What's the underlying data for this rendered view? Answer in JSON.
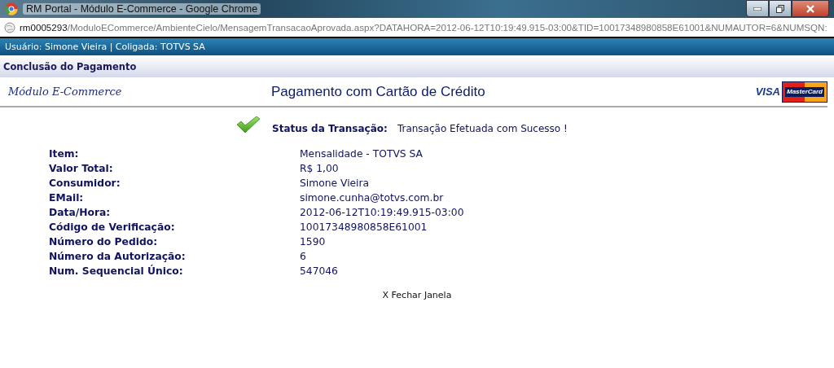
{
  "window": {
    "title": "RM Portal - Módulo E-Commerce - Google Chrome"
  },
  "address_bar": {
    "host": "rm0005293",
    "path": "/ModuloECommerce/AmbienteCielo/MensagemTransacaoAprovada.aspx?DATAHORA=2012-06-12T10:19:49.915-03:00&TID=10017348980858E61001&NUMAUTOR=6&NUMSQN:"
  },
  "user_bar": "Usuário: Simone Vieira | Coligada: TOTVS SA",
  "section_title": "Conclusão do Pagamento",
  "header": {
    "module": "Módulo E-Commerce",
    "title": "Pagamento com Cartão de Crédito",
    "logos": [
      {
        "kind": "visa",
        "label": "VISA"
      },
      {
        "kind": "mastercard",
        "label": "MasterCard"
      }
    ]
  },
  "status": {
    "label": "Status da Transação:",
    "value": "Transação Efetuada com Sucesso !"
  },
  "details": [
    {
      "label": "Item:",
      "value": "Mensalidade - TOTVS SA"
    },
    {
      "label": "Valor Total:",
      "value": "R$ 1,00"
    },
    {
      "label": "Consumidor:",
      "value": "Simone Vieira"
    },
    {
      "label": "EMail:",
      "value": "simone.cunha@totvs.com.br"
    },
    {
      "label": "Data/Hora:",
      "value": "2012-06-12T10:19:49.915-03:00"
    },
    {
      "label": "Código de Verificação:",
      "value": "10017348980858E61001"
    },
    {
      "label": "Número do Pedido:",
      "value": "1590"
    },
    {
      "label": "Número da Autorização:",
      "value": "6"
    },
    {
      "label": "Num. Sequencial Único:",
      "value": "547046"
    }
  ],
  "close_link": "X Fechar Janela"
}
